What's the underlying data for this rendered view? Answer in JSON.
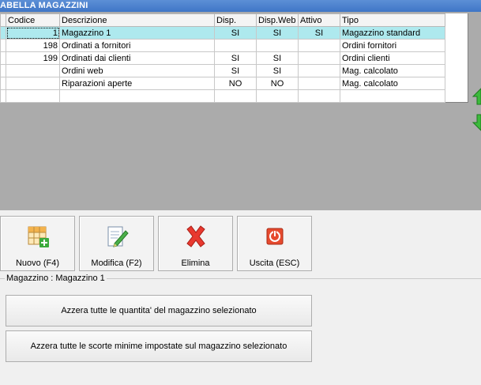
{
  "window": {
    "title": "ABELLA MAGAZZINI"
  },
  "grid": {
    "columns": [
      "Codice",
      "Descrizione",
      "Disp.",
      "Disp.Web",
      "Attivo",
      "Tipo"
    ],
    "rows": [
      {
        "codice": "1",
        "descrizione": "Magazzino 1",
        "disp": "SI",
        "disp_web": "SI",
        "attivo": "SI",
        "tipo": "Magazzino standard"
      },
      {
        "codice": "198",
        "descrizione": "Ordinati a fornitori",
        "disp": "",
        "disp_web": "",
        "attivo": "",
        "tipo": "Ordini fornitori"
      },
      {
        "codice": "199",
        "descrizione": "Ordinati dai clienti",
        "disp": "SI",
        "disp_web": "SI",
        "attivo": "",
        "tipo": "Ordini clienti"
      },
      {
        "codice": "",
        "descrizione": "Ordini web",
        "disp": "SI",
        "disp_web": "SI",
        "attivo": "",
        "tipo": "Mag. calcolato"
      },
      {
        "codice": "",
        "descrizione": "Riparazioni aperte",
        "disp": "NO",
        "disp_web": "NO",
        "attivo": "",
        "tipo": "Mag. calcolato"
      }
    ]
  },
  "toolbar": {
    "new_label": "Nuovo (F4)",
    "edit_label": "Modifica (F2)",
    "delete_label": "Elimina",
    "exit_label": "Uscita (ESC)"
  },
  "group": {
    "label": "Magazzino : Magazzino 1"
  },
  "actions": {
    "reset_qty_label": "Azzera tutte le quantita' del magazzino selezionato",
    "reset_min_label": "Azzera tutte le scorte minime impostate sul magazzino selezionato"
  },
  "colors": {
    "selection": "#aee9ee",
    "accent_title": "#3f76c6"
  }
}
